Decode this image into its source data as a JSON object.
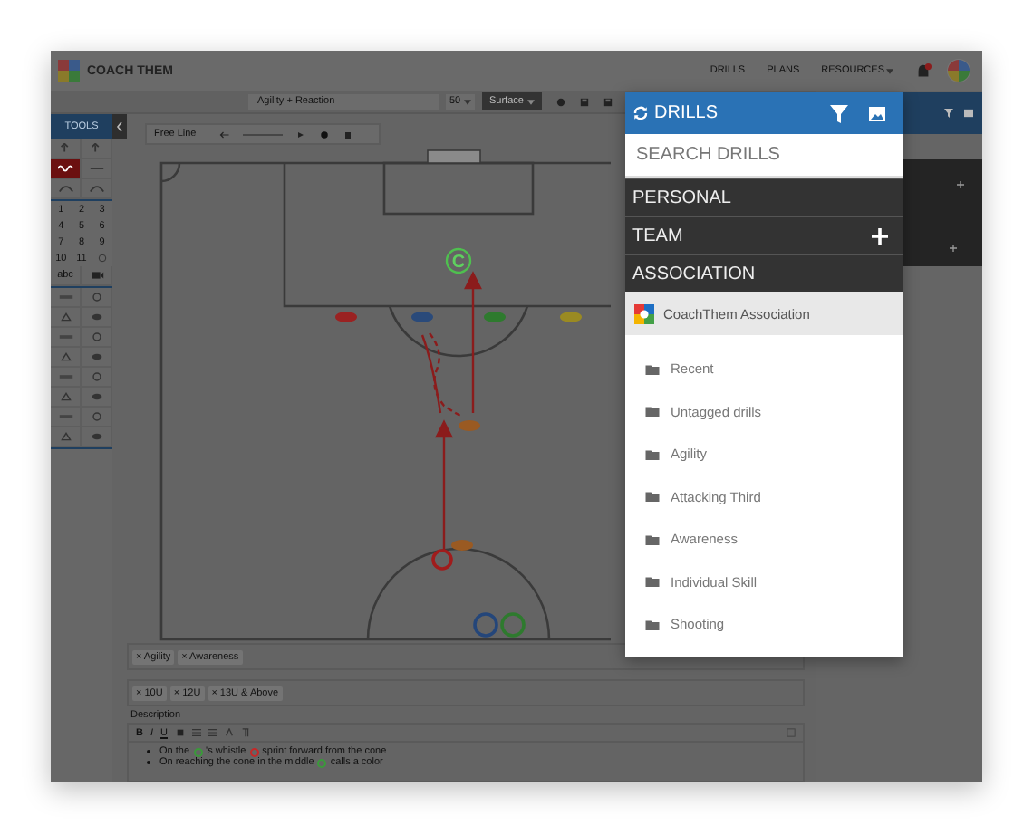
{
  "header": {
    "brand": "COACH THEM",
    "nav": [
      {
        "label": "DRILLS",
        "dropdown": false
      },
      {
        "label": "PLANS",
        "dropdown": false
      },
      {
        "label": "RESOURCES",
        "dropdown": true
      }
    ]
  },
  "toolbar": {
    "drill_title": "Agility + Reaction",
    "size": "50",
    "surface_button": "Surface"
  },
  "tools": {
    "title": "TOOLS",
    "drawing_tools": [
      {
        "selected": false
      },
      {
        "selected": false
      },
      {
        "selected": true
      },
      {
        "selected": false
      },
      {
        "selected": false
      },
      {
        "selected": false
      }
    ],
    "numbers": [
      "1",
      "2",
      "3",
      "4",
      "5",
      "6",
      "7",
      "8",
      "9",
      "10",
      "11"
    ],
    "text_tool": "abc"
  },
  "line_tool": {
    "label": "Free Line"
  },
  "pitch": {
    "coach_marker": "C"
  },
  "tags": [
    "× Agility",
    "× Awareness"
  ],
  "age_groups": [
    "× 10U",
    "× 12U",
    "× 13U & Above"
  ],
  "description": {
    "label": "Description",
    "format_buttons": [
      "B",
      "I",
      "U"
    ],
    "bullets": [
      {
        "parts": [
          "On the",
          "'s whistle",
          "sprint forward from the cone"
        ],
        "markers": [
          {
            "color": "#3a9a3a"
          },
          {
            "color": "#c62828"
          }
        ]
      },
      {
        "parts": [
          "On reaching the cone in the middle",
          "calls a color"
        ],
        "markers": [
          {
            "color": "#3a9a3a"
          }
        ]
      }
    ]
  },
  "drills_panel": {
    "title": "DRILLS",
    "search": {
      "placeholder": "SEARCH DRILLS"
    },
    "sections": [
      {
        "label": "PERSONAL",
        "addable": false
      },
      {
        "label": "TEAM",
        "addable": true
      },
      {
        "label": "ASSOCIATION",
        "addable": false
      }
    ],
    "association": "CoachThem Association",
    "folders": [
      "Recent",
      "Untagged drills",
      "Agility",
      "Attacking Third",
      "Awareness",
      "Individual Skill",
      "Shooting"
    ]
  }
}
